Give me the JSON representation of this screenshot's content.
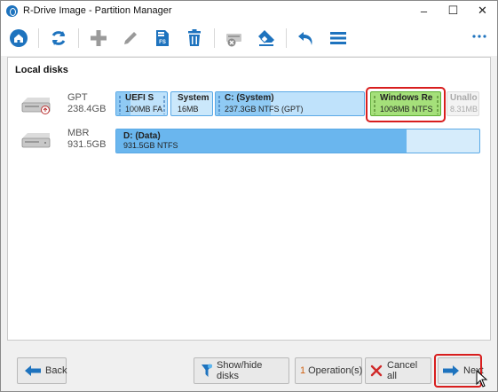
{
  "window": {
    "title": "R-Drive Image - Partition Manager",
    "controls": [
      "–",
      "☐",
      "✕"
    ]
  },
  "toolbar": {
    "icons": [
      "home-icon",
      "refresh-icon",
      "add-icon",
      "edit-icon",
      "format-icon",
      "delete-icon",
      "remove-drive-icon",
      "erase-icon",
      "undo-icon",
      "menu-icon",
      "more-icon"
    ],
    "format_badge": "FS"
  },
  "main": {
    "section_title": "Local disks",
    "disks": [
      {
        "scheme": "GPT",
        "size": "238.4GB",
        "partitions": [
          {
            "name": "UEFI S",
            "desc": "100MB FA",
            "selected": false
          },
          {
            "name": "System",
            "desc": "16MB",
            "selected": false
          },
          {
            "name": "C: (System)",
            "desc": "237.3GB NTFS (GPT)",
            "selected": false
          },
          {
            "name": "Windows Re",
            "desc": "1008MB NTFS",
            "selected": true
          },
          {
            "name": "Unallo",
            "desc": "8.31MB",
            "selected": false
          }
        ]
      },
      {
        "scheme": "MBR",
        "size": "931.5GB",
        "partitions": [
          {
            "name": "D: (Data)",
            "desc": "931.5GB NTFS",
            "used_fraction": 0.8
          }
        ]
      }
    ]
  },
  "footer": {
    "back_label": "Back",
    "show_hide_label": "Show/hide disks",
    "operations_count": "1",
    "operations_label": "Operation(s)",
    "cancel_all_label": "Cancel all",
    "next_label": "Next"
  },
  "colors": {
    "accent": "#1e73be",
    "partition_blue": "#8fcaf4",
    "partition_selected": "#a5e07a",
    "highlight_red": "#d81e1e"
  }
}
